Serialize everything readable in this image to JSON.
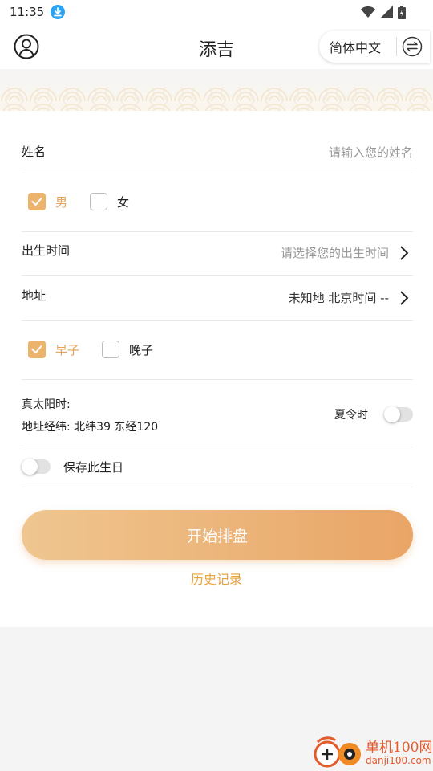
{
  "status_bar": {
    "time": "11:35",
    "icons": [
      "download-icon",
      "wifi-icon",
      "signal-icon",
      "battery-icon"
    ]
  },
  "header": {
    "title": "添吉",
    "language": "简体中文",
    "icons": [
      "user-icon",
      "swap-icon"
    ]
  },
  "form": {
    "name": {
      "label": "姓名",
      "placeholder": "请输入您的姓名"
    },
    "gender": {
      "options": [
        {
          "label": "男",
          "checked": true
        },
        {
          "label": "女",
          "checked": false
        }
      ]
    },
    "birth_time": {
      "label": "出生时间",
      "placeholder": "请选择您的出生时间"
    },
    "address": {
      "label": "地址",
      "value": "未知地 北京时间 --"
    },
    "zi_hour": {
      "options": [
        {
          "label": "早子",
          "checked": true
        },
        {
          "label": "晚子",
          "checked": false
        }
      ]
    },
    "solar_time": {
      "label": "真太阳时:",
      "coords": "地址经纬: 北纬39 东经120",
      "dst_label": "夏令时",
      "dst_on": false
    },
    "save_birthday": {
      "label": "保存此生日",
      "on": false
    }
  },
  "actions": {
    "start_label": "开始排盘",
    "history_label": "历史记录"
  },
  "watermark": {
    "line1": "单机100网",
    "line2": "danji100.com"
  },
  "colors": {
    "accent": "#ebb36b",
    "accent_text": "#e5a25a",
    "link": "#e9a23b",
    "button_start": "#efc690",
    "button_end": "#e9a566"
  }
}
